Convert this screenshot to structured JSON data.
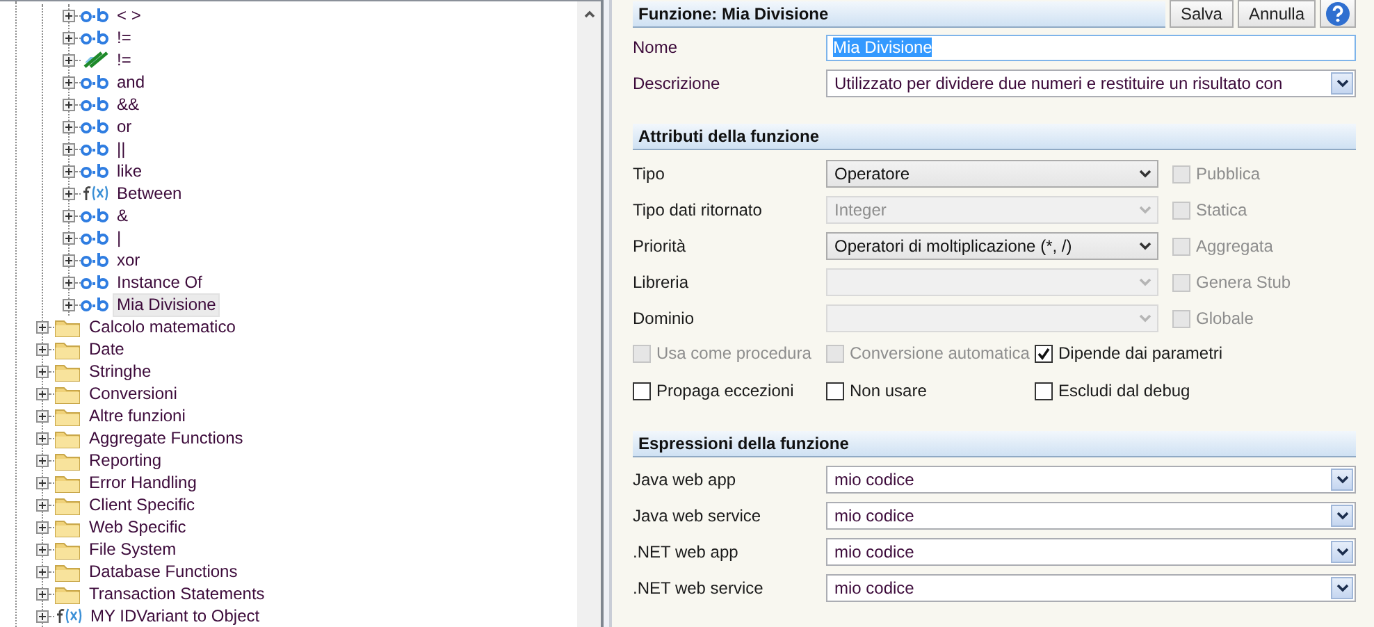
{
  "tree": {
    "items": [
      {
        "children": [
          {
            "kind": "operator",
            "label": "< >",
            "selected": false
          },
          {
            "kind": "operator",
            "label": "!=",
            "selected": false
          },
          {
            "kind": "broken",
            "label": "!=",
            "selected": false
          },
          {
            "kind": "operator",
            "label": "and",
            "selected": false
          },
          {
            "kind": "operator",
            "label": "&&",
            "selected": false
          },
          {
            "kind": "operator",
            "label": "or",
            "selected": false
          },
          {
            "kind": "operator",
            "label": "||",
            "selected": false
          },
          {
            "kind": "operator",
            "label": "like",
            "selected": false
          },
          {
            "kind": "function",
            "label": "Between",
            "selected": false
          },
          {
            "kind": "operator",
            "label": "&",
            "selected": false
          },
          {
            "kind": "operator",
            "label": "|",
            "selected": false
          },
          {
            "kind": "operator",
            "label": "xor",
            "selected": false
          },
          {
            "kind": "operator",
            "label": "Instance Of",
            "selected": false
          },
          {
            "kind": "operator",
            "label": "Mia Divisione",
            "selected": true
          }
        ]
      },
      {
        "kind": "folder",
        "label": "Calcolo matematico",
        "selected": false
      },
      {
        "kind": "folder",
        "label": "Date",
        "selected": false
      },
      {
        "kind": "folder",
        "label": "Stringhe",
        "selected": false
      },
      {
        "kind": "folder",
        "label": "Conversioni",
        "selected": false
      },
      {
        "kind": "folder",
        "label": "Altre funzioni",
        "selected": false
      },
      {
        "kind": "folder",
        "label": "Aggregate Functions",
        "selected": false
      },
      {
        "kind": "folder",
        "label": "Reporting",
        "selected": false
      },
      {
        "kind": "folder",
        "label": "Error Handling",
        "selected": false
      },
      {
        "kind": "folder",
        "label": "Client Specific",
        "selected": false
      },
      {
        "kind": "folder",
        "label": "Web Specific",
        "selected": false
      },
      {
        "kind": "folder",
        "label": "File System",
        "selected": false
      },
      {
        "kind": "folder",
        "label": "Database Functions",
        "selected": false
      },
      {
        "kind": "folder",
        "label": "Transaction Statements",
        "selected": false
      },
      {
        "kind": "function",
        "label": "MY IDVariant to Object",
        "selected": false
      }
    ]
  },
  "form": {
    "title": "Funzione: Mia Divisione",
    "buttons": [
      {
        "kind": "text",
        "label": "Salva"
      },
      {
        "kind": "text",
        "label": "Annulla"
      },
      {
        "kind": "help"
      }
    ],
    "fields": [
      {
        "label": "Nome",
        "kind": "text",
        "value": "Mia Divisione",
        "text_selected": true
      },
      {
        "label": "Descrizione",
        "kind": "combo",
        "value": "Utilizzato per dividere due numeri e restituire un risultato con"
      }
    ],
    "attributes": {
      "title": "Attributi della funzione",
      "rows": [
        {
          "label": "Tipo",
          "value": "Operatore",
          "disabled": false,
          "option": {
            "label": "Pubblica",
            "checked": false,
            "disabled": true
          }
        },
        {
          "label": "Tipo dati ritornato",
          "value": "Integer",
          "disabled": true,
          "option": {
            "label": "Statica",
            "checked": false,
            "disabled": true
          }
        },
        {
          "label": "Priorità",
          "value": "Operatori di moltiplicazione (*, /)",
          "disabled": false,
          "option": {
            "label": "Aggregata",
            "checked": false,
            "disabled": true
          }
        },
        {
          "label": "Libreria",
          "disabled": true,
          "option": {
            "label": "Genera Stub",
            "checked": false,
            "disabled": true
          }
        },
        {
          "label": "Dominio",
          "disabled": true,
          "option": {
            "label": "Globale",
            "checked": false,
            "disabled": true
          }
        }
      ],
      "checkboxes": [
        {
          "label": "Usa come procedura",
          "checked": false,
          "disabled": true
        },
        {
          "label": "Conversione automatica",
          "checked": false,
          "disabled": true
        },
        {
          "label": "Dipende dai parametri",
          "checked": true,
          "disabled": false
        },
        {
          "label": "Propaga eccezioni",
          "checked": false,
          "disabled": false
        },
        {
          "label": "Non usare",
          "checked": false,
          "disabled": false
        },
        {
          "label": "Escludi dal debug",
          "checked": false,
          "disabled": false
        }
      ]
    },
    "expressions": {
      "title": "Espressioni della funzione",
      "rows": [
        {
          "label": "Java web app",
          "value": "mio codice"
        },
        {
          "label": "Java web service",
          "value": "mio codice"
        },
        {
          "label": ".NET web app",
          "value": "mio codice"
        },
        {
          "label": ".NET web service",
          "value": "mio codice"
        }
      ]
    }
  }
}
